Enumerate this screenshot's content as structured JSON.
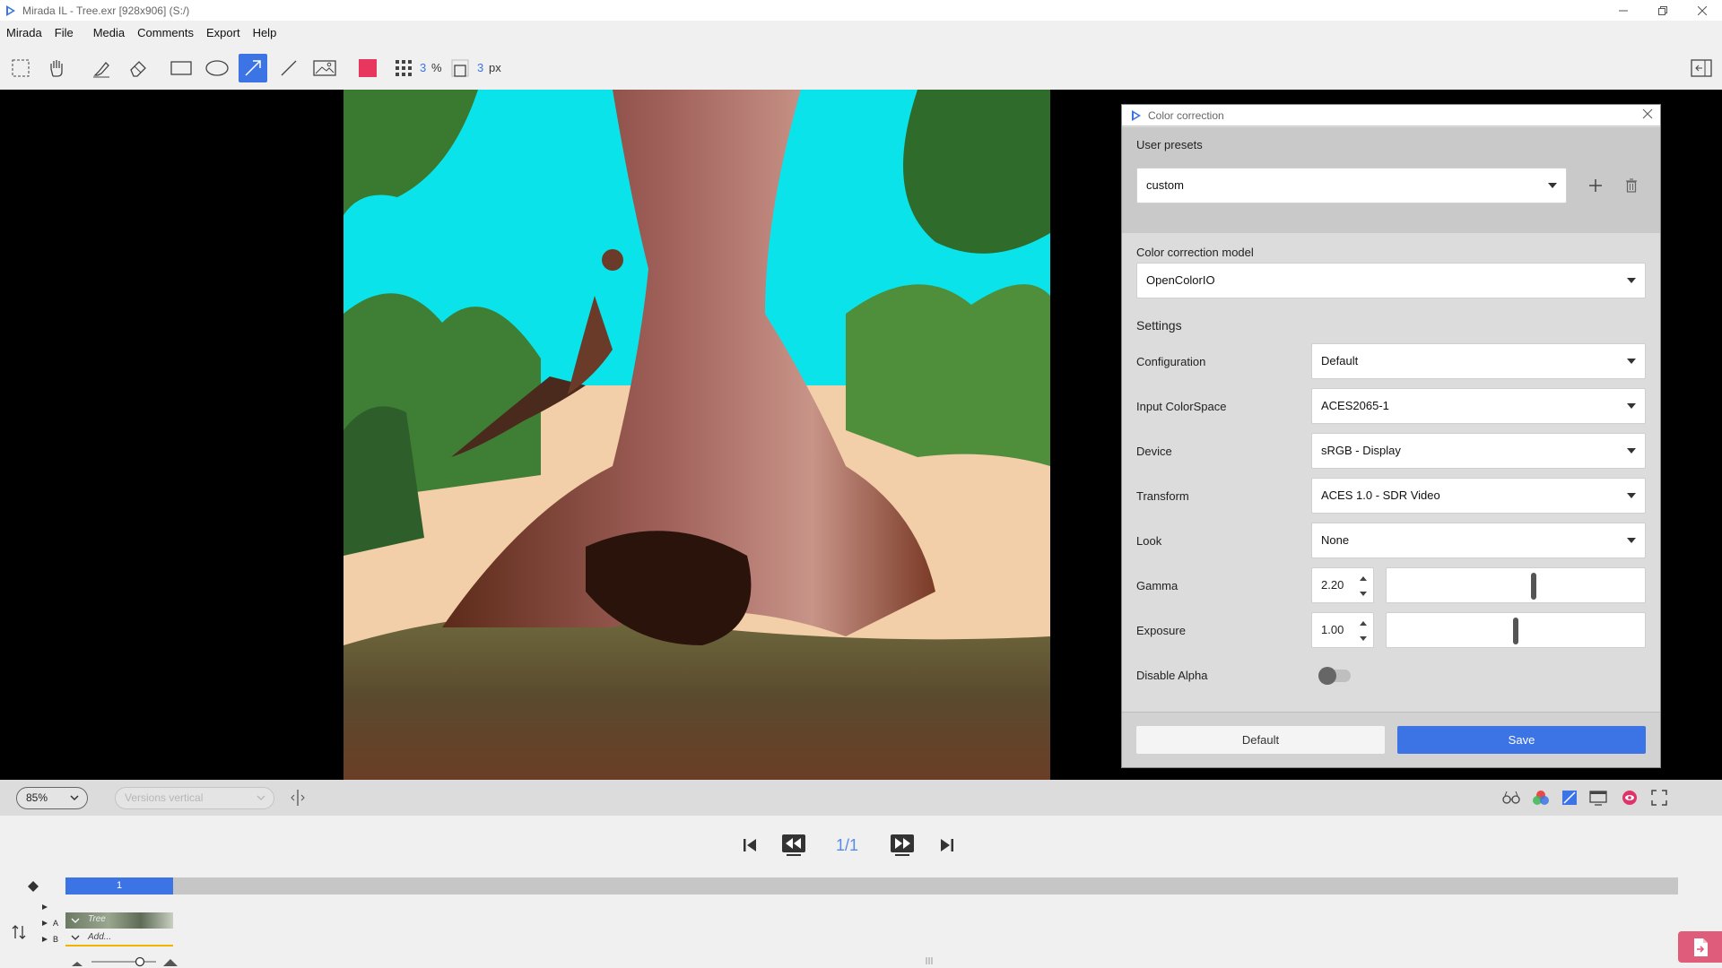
{
  "window": {
    "title": "Mirada IL - Tree.exr [928x906] (S:/)",
    "controls": [
      "minimize",
      "restore",
      "close"
    ]
  },
  "menu": [
    "Mirada",
    "File",
    "Media",
    "Comments",
    "Export",
    "Help"
  ],
  "toolbar": {
    "tools": [
      "marquee-select",
      "pan-hand",
      "highlighter",
      "eraser",
      "rectangle",
      "ellipse",
      "arrow",
      "line",
      "image",
      "color-swatch"
    ],
    "active_tool": "arrow",
    "swatch_color": "#e8375f",
    "grid_value": "3",
    "grid_unit": "%",
    "size_value": "3",
    "size_unit": "px"
  },
  "color_correction": {
    "title": "Color correction",
    "user_presets_label": "User presets",
    "preset_value": "custom",
    "model_label": "Color correction model",
    "model_value": "OpenColorIO",
    "settings_label": "Settings",
    "rows": [
      {
        "label": "Configuration",
        "value": "Default"
      },
      {
        "label": "Input ColorSpace",
        "value": "ACES2065-1"
      },
      {
        "label": "Device",
        "value": "sRGB - Display"
      },
      {
        "label": "Transform",
        "value": "ACES 1.0 - SDR Video"
      },
      {
        "label": "Look",
        "value": "None"
      }
    ],
    "gamma": {
      "label": "Gamma",
      "value": "2.20",
      "slider_fraction": 0.57
    },
    "exposure": {
      "label": "Exposure",
      "value": "1.00",
      "slider_fraction": 0.5
    },
    "disable_alpha": {
      "label": "Disable Alpha",
      "on": false
    },
    "default_button": "Default",
    "save_button": "Save"
  },
  "statusbar": {
    "zoom": "85%",
    "versions_placeholder": "Versions vertical"
  },
  "transport": {
    "frame_counter": "1/1"
  },
  "timeline": {
    "selected_frame": "1",
    "track_a_label": "A",
    "track_b_label": "B",
    "clip_name": "Tree",
    "add_label": "Add..."
  },
  "colors": {
    "accent": "#3c74e6",
    "swatch": "#e8375f",
    "export": "#e05c7b"
  }
}
